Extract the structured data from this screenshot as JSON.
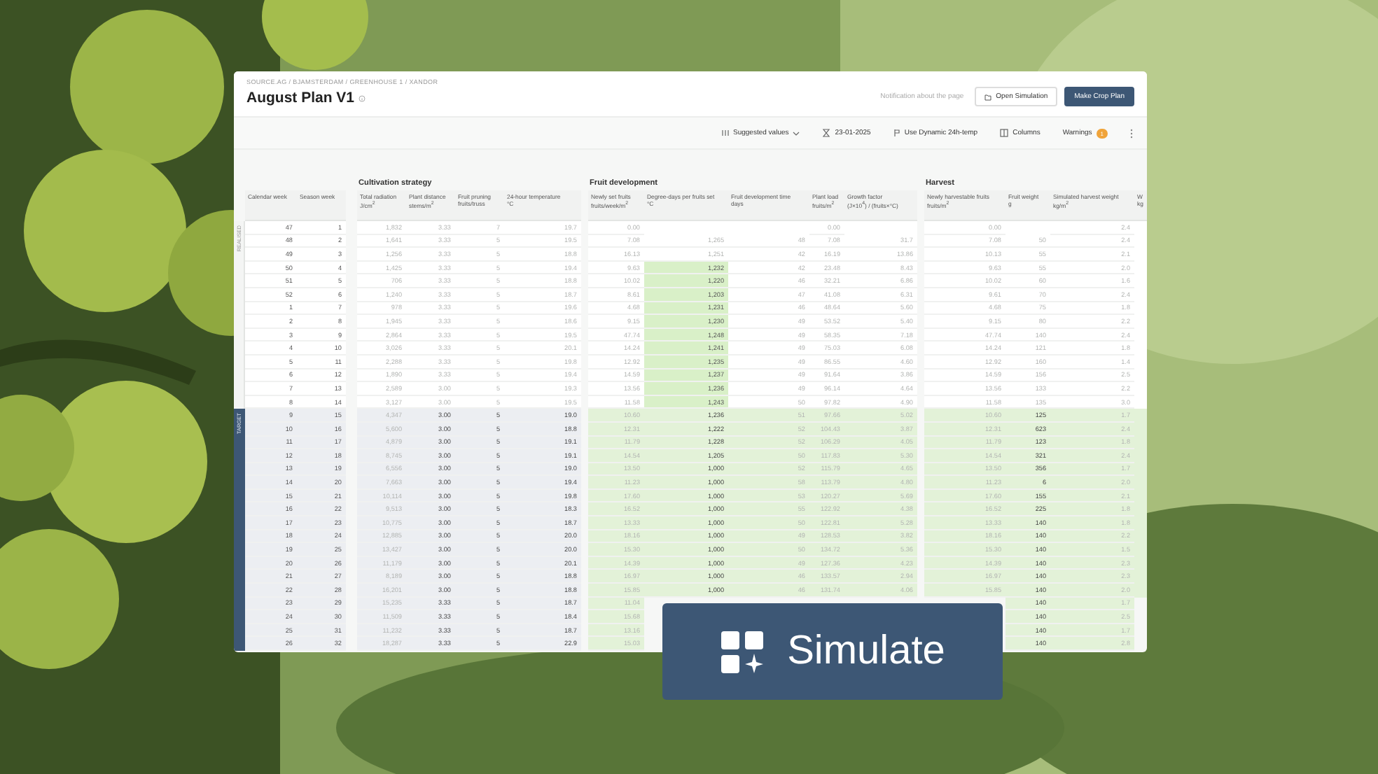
{
  "window": {
    "breadcrumb": "SOURCE.AG / BJAMSTERDAM / GREENHOUSE 1 / XANDOR",
    "title": "August Plan V1",
    "notification": "Notification about the page",
    "buttons": [
      {
        "label": "Open Simulation",
        "kind": "secondary"
      },
      {
        "label": "Make Crop Plan",
        "kind": "primary"
      }
    ]
  },
  "toolbar": [
    {
      "kind": "dropdown",
      "label": "Suggested values"
    },
    {
      "kind": "date",
      "label": "23-01-2025"
    },
    {
      "kind": "toggle",
      "label": "Use Dynamic 24h-temp"
    },
    {
      "kind": "columns",
      "label": "Columns"
    },
    {
      "kind": "warnings",
      "label": "Warnings",
      "count": "1"
    },
    {
      "kind": "more"
    }
  ],
  "table": {
    "week_columns": [
      "Calendar week",
      "Season week"
    ],
    "groups": [
      {
        "title": "Cultivation strategy",
        "columns": [
          {
            "label": "Total radiation",
            "unit": "J/cm$^{2}$"
          },
          {
            "label": "Plant distance",
            "unit": "stems/m$^{2}$"
          },
          {
            "label": "Fruit pruning",
            "unit": "fruits/truss"
          },
          {
            "label": "24-hour temperature",
            "unit": "°C"
          }
        ]
      },
      {
        "title": "Fruit development",
        "columns": [
          {
            "label": "Newly set fruits",
            "unit": "fruits/week/m$^{2}$"
          },
          {
            "label": "Degree-days per fruits set",
            "unit": "°C"
          },
          {
            "label": "Fruit development time",
            "unit": "days"
          },
          {
            "label": "Plant load",
            "unit": "fruits/m$^{2}$"
          },
          {
            "label": "Growth factor",
            "unit": "(J×10$^{4}$) / (fruits×°C)"
          }
        ]
      },
      {
        "title": "Harvest",
        "columns": [
          {
            "label": "Newly harvestable fruits",
            "unit": "fruits/m$^{2}$"
          },
          {
            "label": "Fruit weight",
            "unit": "g"
          },
          {
            "label": "Simulated harvest weight",
            "unit": "kg/m$^{2}$"
          },
          {
            "label": "W",
            "unit": "kg"
          }
        ]
      }
    ],
    "segments": [
      {
        "label": "REALISED",
        "kind": "realised",
        "rows": [
          {
            "week": [
              "47",
              "1"
            ],
            "highlight": false,
            "cells": [
              "1,832",
              "3.33",
              "7",
              "19.7",
              "0.00",
              {},
              {},
              "0.00",
              {},
              "0.00",
              {},
              "2.4"
            ]
          },
          {
            "week": [
              "48",
              "2"
            ],
            "highlight": false,
            "cells": [
              "1,641",
              "3.33",
              "5",
              "19.5",
              "7.08",
              "1,265",
              "48",
              "7.08",
              "31.7",
              "7.08",
              "50",
              "2.4"
            ]
          },
          {
            "week": [
              "49",
              "3"
            ],
            "highlight": false,
            "cells": [
              "1,256",
              "3.33",
              "5",
              "18.8",
              "16.13",
              "1,251",
              "42",
              "16.19",
              "13.86",
              "10.13",
              "55",
              "2.1"
            ]
          },
          {
            "week": [
              "50",
              "4"
            ],
            "highlight": true,
            "cells": [
              "1,425",
              "3.33",
              "5",
              "19.4",
              "9.63",
              "1,232",
              "42",
              "23.48",
              "8.43",
              "9.63",
              "55",
              "2.0"
            ]
          },
          {
            "week": [
              "51",
              "5"
            ],
            "highlight": true,
            "cells": [
              "706",
              "3.33",
              "5",
              "18.8",
              "10.02",
              "1,220",
              "46",
              "32.21",
              "6.86",
              "10.02",
              "60",
              "1.6"
            ]
          },
          {
            "week": [
              "52",
              "6"
            ],
            "highlight": true,
            "cells": [
              "1,240",
              "3.33",
              "5",
              "18.7",
              "8.61",
              "1,203",
              "47",
              "41.08",
              "6.31",
              "9.61",
              "70",
              "2.4"
            ]
          },
          {
            "week": [
              "1",
              "7"
            ],
            "highlight": true,
            "cells": [
              "978",
              "3.33",
              "5",
              "19.6",
              "4.68",
              "1,231",
              "46",
              "48.64",
              "5.60",
              "4.68",
              "75",
              "1.8"
            ]
          },
          {
            "week": [
              "2",
              "8"
            ],
            "highlight": true,
            "cells": [
              "1,945",
              "3.33",
              "5",
              "18.6",
              "9.15",
              "1,230",
              "49",
              "53.52",
              "5.40",
              "9.15",
              "80",
              "2.2"
            ]
          },
          {
            "week": [
              "3",
              "9"
            ],
            "highlight": true,
            "cells": [
              "2,864",
              "3.33",
              "5",
              "19.5",
              "47.74",
              "1,248",
              "49",
              "58.35",
              "7.18",
              "47.74",
              "140",
              "2.4"
            ]
          },
          {
            "week": [
              "4",
              "10"
            ],
            "highlight": true,
            "cells": [
              "3,026",
              "3.33",
              "5",
              "20.1",
              "14.24",
              "1,241",
              "49",
              "75.03",
              "6.08",
              "14.24",
              "121",
              "1.8"
            ]
          },
          {
            "week": [
              "5",
              "11"
            ],
            "highlight": true,
            "cells": [
              "2,288",
              "3.33",
              "5",
              "19.8",
              "12.92",
              "1,235",
              "49",
              "86.55",
              "4.60",
              "12.92",
              "160",
              "1.4"
            ]
          },
          {
            "week": [
              "6",
              "12"
            ],
            "highlight": true,
            "cells": [
              "1,890",
              "3.33",
              "5",
              "19.4",
              "14.59",
              "1,237",
              "49",
              "91.64",
              "3.86",
              "14.59",
              "156",
              "2.5"
            ]
          },
          {
            "week": [
              "7",
              "13"
            ],
            "highlight": true,
            "cells": [
              "2,589",
              "3.00",
              "5",
              "19.3",
              "13.56",
              "1,236",
              "49",
              "96.14",
              "4.64",
              "13.56",
              "133",
              "2.2"
            ]
          },
          {
            "week": [
              "8",
              "14"
            ],
            "highlight": true,
            "cells": [
              "3,127",
              "3.00",
              "5",
              "19.5",
              "11.58",
              "1,243",
              "50",
              "97.82",
              "4.90",
              "11.58",
              "135",
              "3.0"
            ]
          }
        ]
      },
      {
        "label": "TARGET",
        "kind": "target",
        "rows": [
          {
            "week": [
              "9",
              "15"
            ],
            "highlight": false,
            "cells": [
              "4,347",
              "3.00",
              "5",
              "19.0",
              "10.60",
              "1,236",
              "51",
              "97.66",
              "5.02",
              "10.60",
              "125",
              "1.7"
            ]
          },
          {
            "week": [
              "10",
              "16"
            ],
            "highlight": false,
            "cells": [
              "5,600",
              "3.00",
              "5",
              "18.8",
              "12.31",
              "1,222",
              "52",
              "104.43",
              "3.87",
              "12.31",
              "623",
              "2.4"
            ]
          },
          {
            "week": [
              "11",
              "17"
            ],
            "highlight": false,
            "cells": [
              "4,879",
              "3.00",
              "5",
              "19.1",
              "11.79",
              "1,228",
              "52",
              "106.29",
              "4.05",
              "11.79",
              "123",
              "1.8"
            ]
          },
          {
            "week": [
              "12",
              "18"
            ],
            "highlight": false,
            "cells": [
              "8,745",
              "3.00",
              "5",
              "19.1",
              "14.54",
              "1,205",
              "50",
              "117.83",
              "5.30",
              "14.54",
              "321",
              "2.4"
            ]
          },
          {
            "week": [
              "13",
              "19"
            ],
            "highlight": false,
            "cells": [
              "6,556",
              "3.00",
              "5",
              "19.0",
              "13.50",
              "1,000",
              "52",
              "115.79",
              "4.65",
              "13.50",
              "356",
              "1.7"
            ]
          },
          {
            "week": [
              "14",
              "20"
            ],
            "highlight": false,
            "cells": [
              "7,663",
              "3.00",
              "5",
              "19.4",
              "11.23",
              "1,000",
              "58",
              "113.79",
              "4.80",
              "11.23",
              "6",
              "2.0"
            ]
          },
          {
            "week": [
              "15",
              "21"
            ],
            "highlight": false,
            "cells": [
              "10,114",
              "3.00",
              "5",
              "19.8",
              "17.60",
              "1,000",
              "53",
              "120.27",
              "5.69",
              "17.60",
              "155",
              "2.1"
            ]
          },
          {
            "week": [
              "16",
              "22"
            ],
            "highlight": false,
            "cells": [
              "9,513",
              "3.00",
              "5",
              "18.3",
              "16.52",
              "1,000",
              "55",
              "122.92",
              "4.38",
              "16.52",
              "225",
              "1.8"
            ]
          },
          {
            "week": [
              "17",
              "23"
            ],
            "highlight": false,
            "cells": [
              "10,775",
              "3.00",
              "5",
              "18.7",
              "13.33",
              "1,000",
              "50",
              "122.81",
              "5.28",
              "13.33",
              "140",
              "1.8"
            ]
          },
          {
            "week": [
              "18",
              "24"
            ],
            "highlight": false,
            "cells": [
              "12,885",
              "3.00",
              "5",
              "20.0",
              "18.16",
              "1,000",
              "49",
              "128.53",
              "3.82",
              "18.16",
              "140",
              "2.2"
            ]
          },
          {
            "week": [
              "19",
              "25"
            ],
            "highlight": false,
            "cells": [
              "13,427",
              "3.00",
              "5",
              "20.0",
              "15.30",
              "1,000",
              "50",
              "134.72",
              "5.36",
              "15.30",
              "140",
              "1.5"
            ]
          },
          {
            "week": [
              "20",
              "26"
            ],
            "highlight": false,
            "cells": [
              "11,179",
              "3.00",
              "5",
              "20.1",
              "14.39",
              "1,000",
              "49",
              "127.36",
              "4.23",
              "14.39",
              "140",
              "2.3"
            ]
          },
          {
            "week": [
              "21",
              "27"
            ],
            "highlight": false,
            "cells": [
              "8,189",
              "3.00",
              "5",
              "18.8",
              "16.97",
              "1,000",
              "46",
              "133.57",
              "2.94",
              "16.97",
              "140",
              "2.3"
            ]
          },
          {
            "week": [
              "22",
              "28"
            ],
            "highlight": false,
            "cells": [
              "16,201",
              "3.00",
              "5",
              "18.8",
              "15.85",
              "1,000",
              "46",
              "131.74",
              "4.06",
              "15.85",
              "140",
              "2.0"
            ]
          },
          {
            "week": [
              "23",
              "29"
            ],
            "cells": [
              "15,235",
              "3.33",
              "5",
              "18.7",
              "11.04",
              {},
              {},
              {},
              {},
              {},
              "140",
              "1.7"
            ]
          },
          {
            "week": [
              "24",
              "30"
            ],
            "cells": [
              "11,509",
              "3.33",
              "5",
              "18.4",
              "15.68",
              {},
              {},
              {},
              {},
              {},
              "140",
              "2.5"
            ]
          },
          {
            "week": [
              "25",
              "31"
            ],
            "cells": [
              "11,232",
              "3.33",
              "5",
              "18.7",
              "13.16",
              {},
              {},
              {},
              {},
              {},
              "140",
              "1.7"
            ]
          },
          {
            "week": [
              "26",
              "32"
            ],
            "cells": [
              "18,287",
              "3.33",
              "5",
              "22.9",
              "15.03",
              {},
              {},
              {},
              {},
              {},
              "140",
              "2.8"
            ]
          }
        ]
      }
    ]
  },
  "overlay_button": {
    "label": "Simulate"
  }
}
